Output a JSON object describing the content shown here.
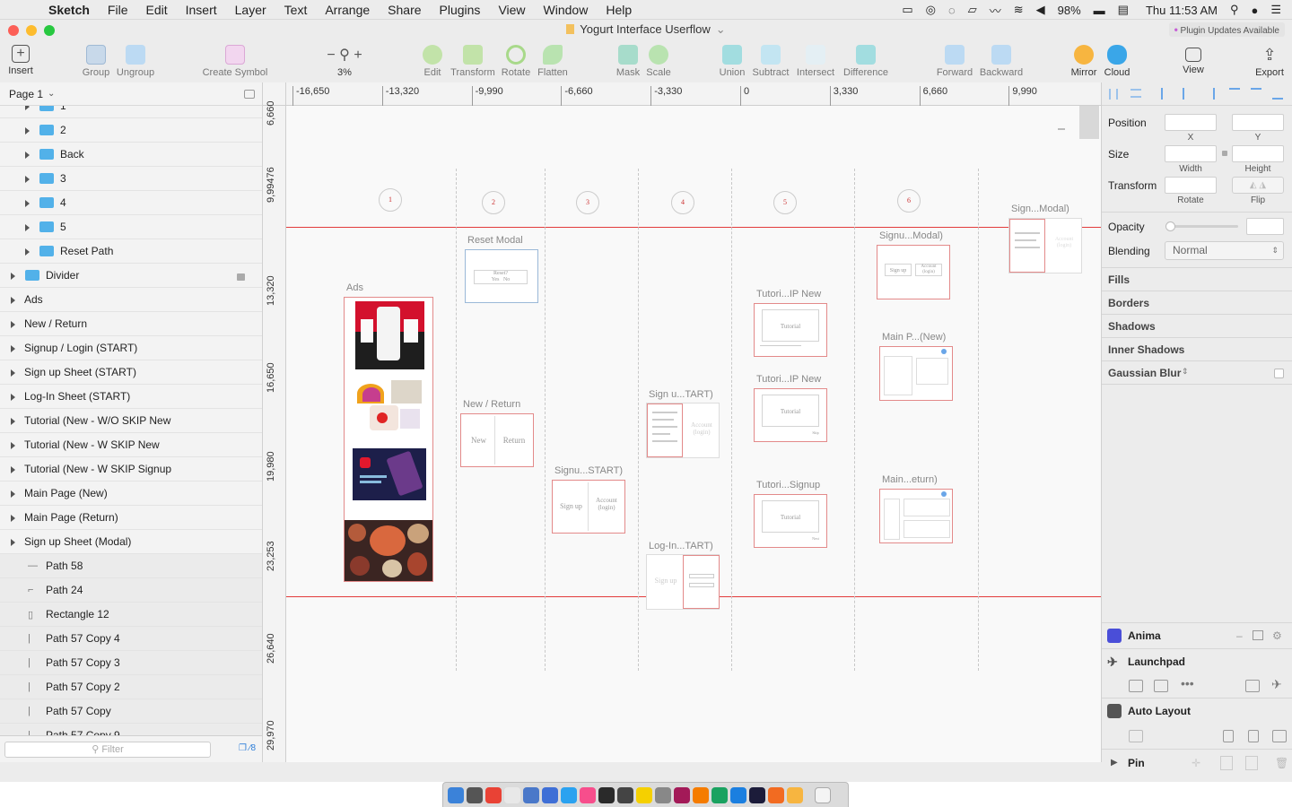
{
  "menubar": {
    "app": "Sketch",
    "items": [
      "File",
      "Edit",
      "Insert",
      "Layer",
      "Text",
      "Arrange",
      "Share",
      "Plugins",
      "View",
      "Window",
      "Help"
    ],
    "battery": "98%",
    "clock": "Thu 11:53 AM"
  },
  "window": {
    "title": "Yogurt Interface Userflow",
    "plugin_badge": "Plugin Updates Available"
  },
  "toolbar": {
    "insert": "Insert",
    "group": "Group",
    "ungroup": "Ungroup",
    "create_symbol": "Create Symbol",
    "zoom": "3%",
    "edit": "Edit",
    "transform": "Transform",
    "rotate": "Rotate",
    "flatten": "Flatten",
    "mask": "Mask",
    "scale": "Scale",
    "union": "Union",
    "subtract": "Subtract",
    "intersect": "Intersect",
    "difference": "Difference",
    "forward": "Forward",
    "backward": "Backward",
    "mirror": "Mirror",
    "cloud": "Cloud",
    "view": "View",
    "export": "Export"
  },
  "pages": {
    "current": "Page 1"
  },
  "layers": [
    {
      "label": "1",
      "kind": "folder",
      "indent": 1
    },
    {
      "label": "2",
      "kind": "folder",
      "indent": 1
    },
    {
      "label": "Back",
      "kind": "folder",
      "indent": 1
    },
    {
      "label": "3",
      "kind": "folder",
      "indent": 1
    },
    {
      "label": "4",
      "kind": "folder",
      "indent": 1
    },
    {
      "label": "5",
      "kind": "folder",
      "indent": 1
    },
    {
      "label": "Reset Path",
      "kind": "folder",
      "indent": 1
    },
    {
      "label": "Divider",
      "kind": "folder",
      "indent": 0,
      "locked": true
    },
    {
      "label": "Ads",
      "kind": "artboard"
    },
    {
      "label": "New /  Return",
      "kind": "artboard"
    },
    {
      "label": "Signup / Login (START)",
      "kind": "artboard"
    },
    {
      "label": "Sign up Sheet (START)",
      "kind": "artboard"
    },
    {
      "label": "Log-In Sheet (START)",
      "kind": "artboard"
    },
    {
      "label": "Tutorial (New - W/O SKIP New",
      "kind": "artboard"
    },
    {
      "label": "Tutorial (New - W SKIP New",
      "kind": "artboard"
    },
    {
      "label": "Tutorial (New - W SKIP Signup",
      "kind": "artboard"
    },
    {
      "label": "Main Page (New)",
      "kind": "artboard"
    },
    {
      "label": "Main Page (Return)",
      "kind": "artboard"
    },
    {
      "label": "Sign up Sheet (Modal)",
      "kind": "artboard"
    },
    {
      "label": "Path 58",
      "kind": "shape",
      "glyph": "—"
    },
    {
      "label": "Path 24",
      "kind": "shape",
      "glyph": "⌐"
    },
    {
      "label": "Rectangle 12",
      "kind": "shape",
      "glyph": "▯"
    },
    {
      "label": "Path 57 Copy 4",
      "kind": "shape",
      "glyph": "|"
    },
    {
      "label": "Path 57 Copy 3",
      "kind": "shape",
      "glyph": "|"
    },
    {
      "label": "Path 57 Copy 2",
      "kind": "shape",
      "glyph": "|"
    },
    {
      "label": "Path 57 Copy",
      "kind": "shape",
      "glyph": "|"
    },
    {
      "label": "Path 57 Copy 9",
      "kind": "shape",
      "glyph": "|"
    }
  ],
  "filter": {
    "placeholder": "Filter",
    "count": "8"
  },
  "rulers": {
    "h": [
      "-16,650",
      "-13,320",
      "-9,990",
      "-6,660",
      "-3,330",
      "0",
      "3,330",
      "6,660",
      "9,990"
    ],
    "v": [
      "6,660",
      "9,99476",
      "13,320",
      "16,650",
      "19,980",
      "23,253",
      "26,640",
      "29,970"
    ]
  },
  "canvas": {
    "steps": [
      "1",
      "2",
      "3",
      "4",
      "5",
      "6"
    ],
    "artboards": {
      "ads": "Ads",
      "reset": "Reset Modal",
      "newreturn": "New /  Return",
      "signupstart": "Signu...START)",
      "signuptart": "Sign u...TART)",
      "loginstart": "Log-In...TART)",
      "tut1": "Tutori...IP New",
      "tut2": "Tutori...IP New",
      "tut3": "Tutori...Signup",
      "signmodal": "Signu...Modal)",
      "mainnew": "Main P...(New)",
      "mainret": "Main...eturn)",
      "signmodal2": "Sign...Modal)"
    },
    "mock": {
      "reset": "Reset?",
      "yes": "Yes",
      "no": "No",
      "new": "New",
      "return": "Return",
      "signup": "Sign up",
      "account": "Account (login)",
      "tutorial": "Tutorial",
      "skip": "Skip",
      "next": "Next"
    }
  },
  "inspector": {
    "position": "Position",
    "x": "X",
    "y": "Y",
    "size": "Size",
    "width": "Width",
    "height": "Height",
    "transform": "Transform",
    "rotate": "Rotate",
    "flip": "Flip",
    "opacity": "Opacity",
    "blending": "Blending",
    "blending_value": "Normal",
    "sections": [
      "Fills",
      "Borders",
      "Shadows",
      "Inner Shadows",
      "Gaussian Blur"
    ]
  },
  "plugins": {
    "anima": "Anima",
    "launchpad": "Launchpad",
    "autolayout": "Auto Layout",
    "pin": "Pin"
  },
  "colors": {
    "accent": "#2f7fd9",
    "guide_red": "#e23c3c",
    "folder_blue": "#52b1e9"
  }
}
